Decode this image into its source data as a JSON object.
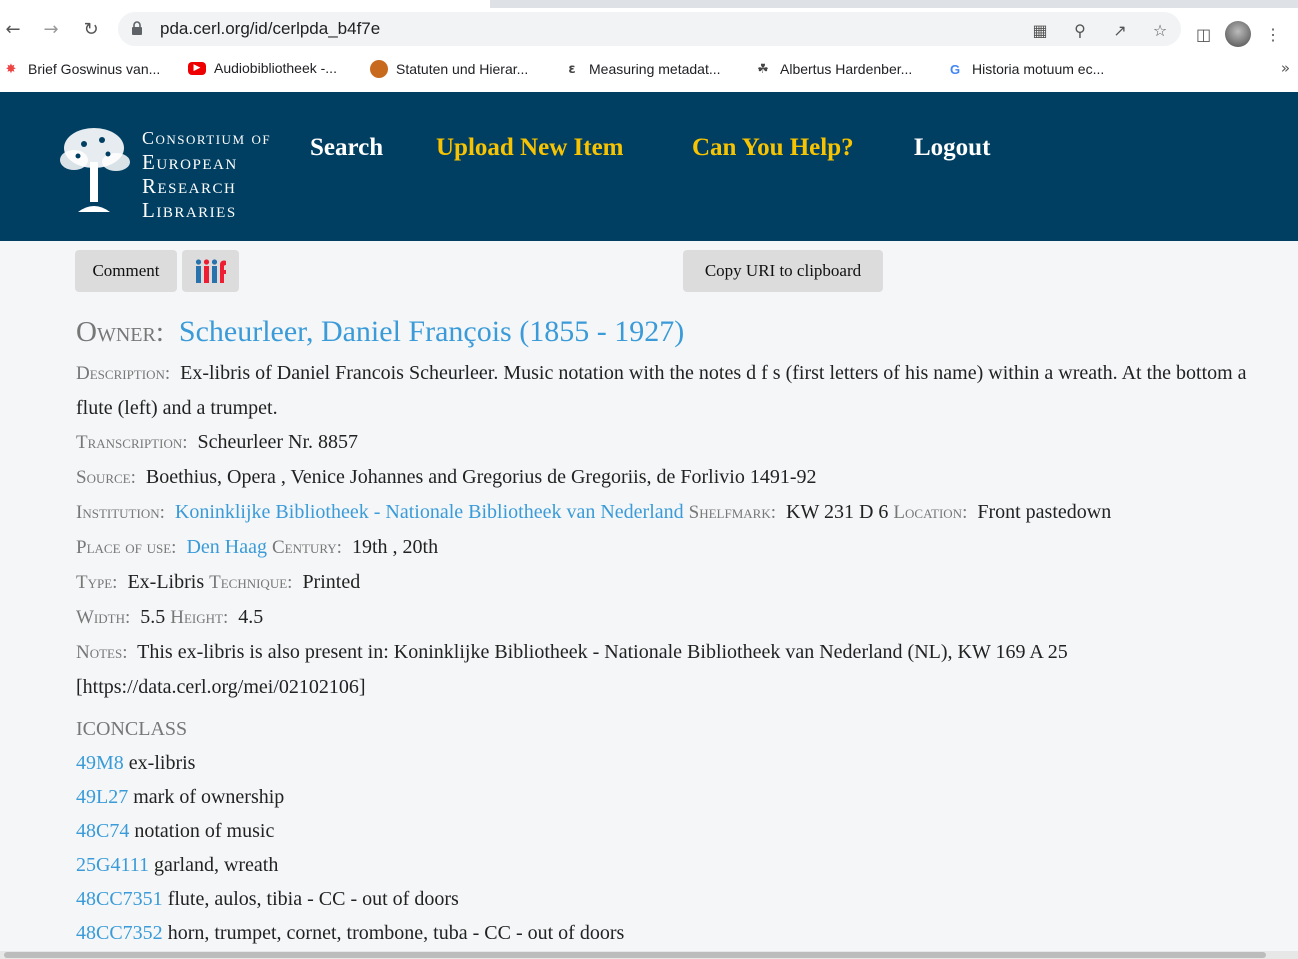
{
  "browser": {
    "url": "pda.cerl.org/id/cerlpda_b4f7e",
    "bookmarks": [
      {
        "label": "Brief Goswinus van...",
        "icon": "joomla-icon"
      },
      {
        "label": "Audiobibliotheek -...",
        "icon": "youtube-icon"
      },
      {
        "label": "Statuten und Hierar...",
        "icon": "avatar-icon"
      },
      {
        "label": "Measuring metadat...",
        "icon": "e-logo-icon"
      },
      {
        "label": "Albertus Hardenber...",
        "icon": "tree-icon"
      },
      {
        "label": "Historia motuum ec...",
        "icon": "google-icon"
      }
    ],
    "more": "»"
  },
  "site": {
    "logo": [
      "Consortium of",
      "European",
      "Research",
      "Libraries"
    ],
    "menu": {
      "search": "Search",
      "upload": "Upload New Item",
      "help": "Can You Help?",
      "logout": "Logout"
    }
  },
  "toolbar": {
    "comment": "Comment",
    "copy_uri": "Copy URI to clipboard"
  },
  "record": {
    "owner_label": "Owner:",
    "owner": "Scheurleer, Daniel François (1855 - 1927)",
    "description_label": "Description:",
    "description": "Ex-libris of Daniel Francois Scheurleer. Music notation with the notes d f s (first letters of his name) within a wreath. At the bottom a flute (left) and a trumpet.",
    "transcription_label": "Transcription:",
    "transcription": "Scheurleer Nr. 8857",
    "source_label": "Source:",
    "source": "Boethius, Opera , Venice Johannes and Gregorius de Gregoriis, de Forlivio 1491-92",
    "institution_label": "Institution:",
    "institution": "Koninklijke Bibliotheek - Nationale Bibliotheek van Nederland",
    "shelfmark_label": "Shelfmark:",
    "shelfmark": "KW 231 D 6",
    "location_label": "Location:",
    "location": "Front pastedown",
    "place_label": "Place of use:",
    "place": "Den Haag",
    "century_label": "Century:",
    "century": "19th , 20th",
    "type_label": "Type:",
    "type": "Ex-Libris",
    "technique_label": "Technique:",
    "technique": "Printed",
    "width_label": "Width:",
    "width": "5.5",
    "height_label": "Height:",
    "height": "4.5",
    "notes_label": "Notes:",
    "notes": "This ex-libris is also present in: Koninklijke Bibliotheek - Nationale Bibliotheek van Nederland (NL), KW 169 A 25 [https://data.cerl.org/mei/02102106]"
  },
  "iconclass": {
    "heading": "ICONCLASS",
    "items": [
      {
        "code": "49M8",
        "label": "ex-libris"
      },
      {
        "code": "49L27",
        "label": "mark of ownership"
      },
      {
        "code": "48C74",
        "label": "notation of music"
      },
      {
        "code": "25G4111",
        "label": "garland, wreath"
      },
      {
        "code": "48CC7351",
        "label": "flute, aulos, tibia - CC - out of doors"
      },
      {
        "code": "48CC7352",
        "label": "horn, trumpet, cornet, trombone, tuba - CC - out of doors"
      }
    ]
  },
  "colors": {
    "header_bg": "#003f62",
    "menu_yellow": "#f8c300",
    "link": "#3a9bd8",
    "label": "#777777"
  }
}
